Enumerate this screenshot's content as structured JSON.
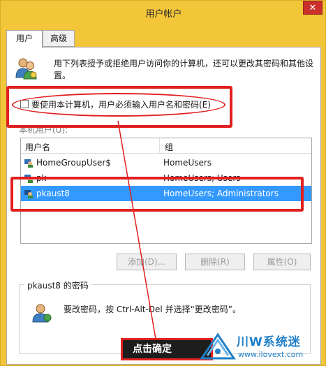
{
  "window": {
    "title": "用户帐户",
    "close_glyph": "✕"
  },
  "tabs": [
    {
      "label": "用户"
    },
    {
      "label": "高级"
    }
  ],
  "description": "用下列表授予或拒绝用户访问你的计算机，还可以更改其密码和其他设置。",
  "require_password": {
    "label": "要使用本计算机，用户必须输入用户名和密码(E)",
    "checked": false
  },
  "users_list": {
    "label": "本机用户(U):",
    "columns": [
      "用户名",
      "组"
    ],
    "rows": [
      {
        "name": "HomeGroupUser$",
        "group": "HomeUsers"
      },
      {
        "name": "pk",
        "group": "HomeUsers; Users"
      },
      {
        "name": "pkaust8",
        "group": "HomeUsers; Administrators"
      }
    ],
    "selected_index": 2
  },
  "buttons": {
    "add": "添加(D)...",
    "delete": "删除(R)",
    "properties": "属性(O)"
  },
  "password_group": {
    "title": "pkaust8 的密码",
    "text": "要改密码，按 Ctrl-Alt-Del 并选择“更改密码”。"
  },
  "annotation": {
    "callout": "点击确定",
    "highlight_color": "#e02020"
  },
  "watermark": {
    "title": "川W系统迷",
    "url": "www.ilovext.com"
  },
  "colors": {
    "window_frame": "#f3c63a",
    "selection": "#3399ff",
    "close": "#c9302c"
  }
}
